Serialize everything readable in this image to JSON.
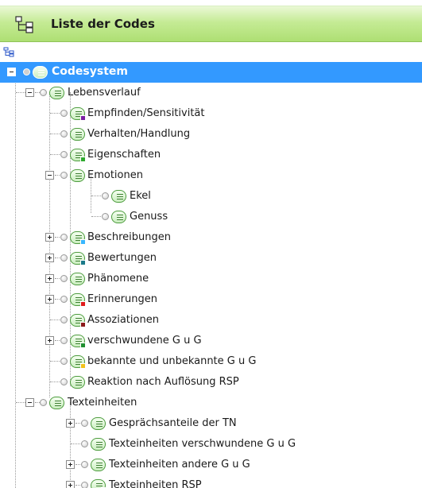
{
  "panel": {
    "title": "Liste der Codes"
  },
  "tree": {
    "root": {
      "label": "Codesystem"
    },
    "items": [
      {
        "label": "Lebensverlauf",
        "color": ""
      },
      {
        "label": "Empfinden/Sensitivität",
        "color": "#7a1fa2"
      },
      {
        "label": "Verhalten/Handlung",
        "color": ""
      },
      {
        "label": "Eigenschaften",
        "color": "#2eaa2e"
      },
      {
        "label": "Emotionen",
        "color": ""
      },
      {
        "label": "Ekel",
        "color": ""
      },
      {
        "label": "Genuss",
        "color": ""
      },
      {
        "label": "Beschreibungen",
        "color": "#38b6ff"
      },
      {
        "label": "Bewertungen",
        "color": "#1b7a8a"
      },
      {
        "label": "Phänomene",
        "color": ""
      },
      {
        "label": "Erinnerungen",
        "color": "#e01b1b"
      },
      {
        "label": "Assoziationen",
        "color": "#8b1a1a"
      },
      {
        "label": "verschwundene G u G",
        "color": "#1f8f2f"
      },
      {
        "label": "bekannte und unbekannte G u G",
        "color": "#f2c21b"
      },
      {
        "label": "Reaktion nach Auflösung RSP",
        "color": ""
      },
      {
        "label": "Texteinheiten",
        "color": ""
      },
      {
        "label": "Gesprächsanteile der TN",
        "color": ""
      },
      {
        "label": "Texteinheiten verschwundene G u G",
        "color": ""
      },
      {
        "label": "Texteinheiten andere G u G",
        "color": ""
      },
      {
        "label": "Texteinheiten RSP",
        "color": "#2a4fd0"
      }
    ]
  }
}
